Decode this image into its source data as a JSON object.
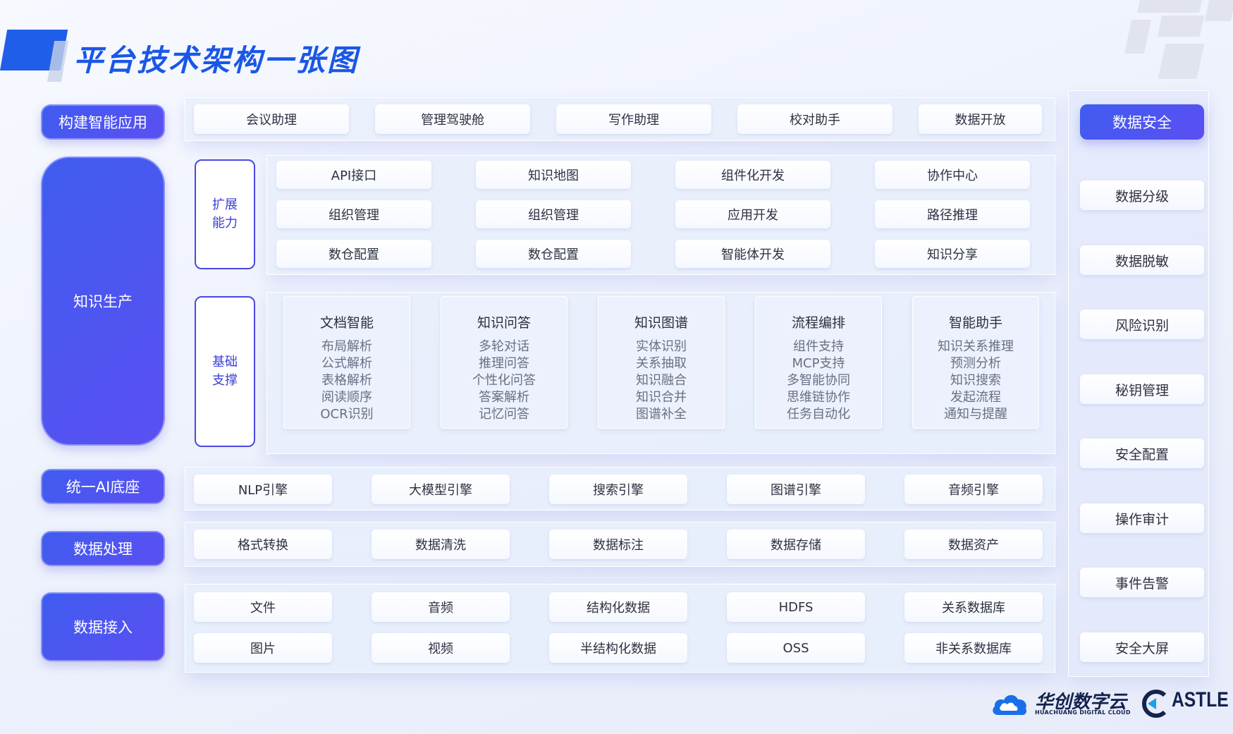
{
  "title": "平台技术架构一张图",
  "left_labels": {
    "app": "构建智能应用",
    "knowledge": "知识生产",
    "ai_base": "统一AI底座",
    "processing": "数据处理",
    "ingest": "数据接入"
  },
  "apps": [
    "会议助理",
    "管理驾驶舱",
    "写作助理",
    "校对助手",
    "数据开放"
  ],
  "extend": {
    "label_line1": "扩展",
    "label_line2": "能力",
    "rows": [
      [
        "API接口",
        "知识地图",
        "组件化开发",
        "协作中心"
      ],
      [
        "组织管理",
        "组织管理",
        "应用开发",
        "路径推理"
      ],
      [
        "数仓配置",
        "数仓配置",
        "智能体开发",
        "知识分享"
      ]
    ]
  },
  "base": {
    "label_line1": "基础",
    "label_line2": "支撑",
    "modules": [
      {
        "title": "文档智能",
        "items": [
          "布局解析",
          "公式解析",
          "表格解析",
          "阅读顺序",
          "OCR识别"
        ]
      },
      {
        "title": "知识问答",
        "items": [
          "多轮对话",
          "推理问答",
          "个性化问答",
          "答案解析",
          "记忆问答"
        ]
      },
      {
        "title": "知识图谱",
        "items": [
          "实体识别",
          "关系抽取",
          "知识融合",
          "知识合并",
          "图谱补全"
        ]
      },
      {
        "title": "流程编排",
        "items": [
          "组件支持",
          "MCP支持",
          "多智能协同",
          "思维链协作",
          "任务自动化"
        ]
      },
      {
        "title": "智能助手",
        "items": [
          "知识关系推理",
          "预测分析",
          "知识搜索",
          "发起流程",
          "通知与提醒"
        ]
      }
    ]
  },
  "engines": [
    "NLP引擎",
    "大模型引擎",
    "搜索引擎",
    "图谱引擎",
    "音频引擎"
  ],
  "processing": [
    "格式转换",
    "数据清洗",
    "数据标注",
    "数据存储",
    "数据资产"
  ],
  "ingest": {
    "row1": [
      "文件",
      "音频",
      "结构化数据",
      "HDFS",
      "关系数据库"
    ],
    "row2": [
      "图片",
      "视频",
      "半结构化数据",
      "OSS",
      "非关系数据库"
    ]
  },
  "security": {
    "title": "数据安全",
    "items": [
      "数据分级",
      "数据脱敏",
      "风险识别",
      "秘钥管理",
      "安全配置",
      "操作审计",
      "事件告警",
      "安全大屏"
    ]
  },
  "logos": {
    "huachuang_cn": "华创数字云",
    "huachuang_en": "HUACHUANG DIGITAL CLOUD",
    "castle": "ASTLE"
  },
  "colors": {
    "accent": "#1a57e6",
    "pill": "#4a55f0",
    "tag_border": "#4b48e0"
  }
}
